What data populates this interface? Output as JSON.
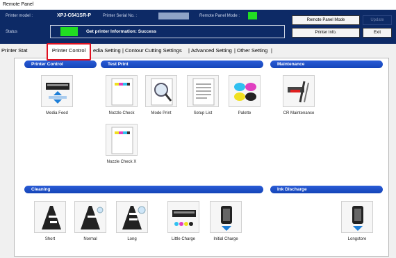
{
  "window": {
    "title": "Remote Panel"
  },
  "header": {
    "model_label": "Printer model :",
    "model_value": "XPJ-C641SR-P",
    "serial_label": "Printer Serial No. :",
    "remote_label": "Remote Panel Mode :",
    "status_label": "Status",
    "status_text": "Get printer Information: Success",
    "buttons": {
      "remote_mode": "Remote Panel Mode",
      "update": "Update",
      "printer_info": "Printer Info.",
      "exit": "Exit"
    },
    "indicator_color": "#22dd22"
  },
  "tabs": [
    {
      "label": "Printer Stat"
    },
    {
      "label": "Printer Control"
    },
    {
      "label": "edia Setting"
    },
    {
      "label": "Contour Cutting Settings"
    },
    {
      "label": "Advanced Setting"
    },
    {
      "label": "Other Setting"
    }
  ],
  "sections": {
    "printer_control": "Printer Control",
    "test_print": "Test Print",
    "maintenance": "Maintenance",
    "cleaning": "Cleaning",
    "ink_discharge": "Ink Discharge"
  },
  "items": {
    "media_feed": "Media Feed",
    "nozzle_check": "Nozzle Check",
    "mode_print": "Mode Print",
    "setup_list": "Setup List",
    "palette": "Palette",
    "cr_maintenance": "CR Maintenance",
    "nozzle_check_x": "Nozzle Check X",
    "short": "Short",
    "normal": "Normal",
    "long": "Long",
    "little_charge": "Little Charge",
    "initial_charge": "Initial Charge",
    "longstore": "Longstore"
  },
  "colors": {
    "accent": "#1444b8",
    "header_bg": "#0d2a66",
    "highlight": "#e01020"
  }
}
